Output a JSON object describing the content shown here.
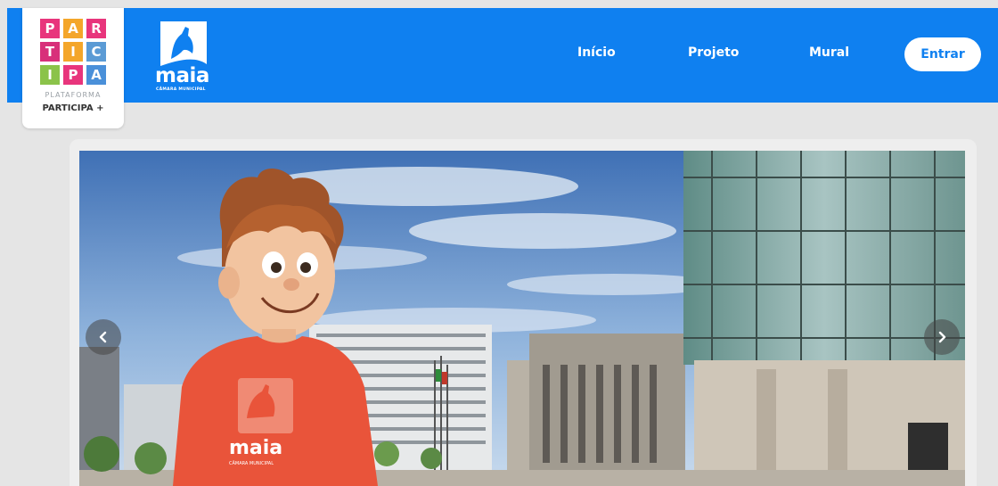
{
  "brand": {
    "logo_letters": [
      "P",
      "A",
      "R",
      "T",
      "I",
      "C",
      "I",
      "P",
      "A"
    ],
    "logo_colors": [
      "#e8357c",
      "#f4a62a",
      "#e8357c",
      "#d8307a",
      "#f4a62a",
      "#5b9bd5",
      "#8bc34a",
      "#e8357c",
      "#4a90d9"
    ],
    "platform_label": "PLATAFORMA",
    "platform_name": "PARTICIPA +"
  },
  "municipality": {
    "name": "maia",
    "subtitle": "CÂMARA MUNICIPAL"
  },
  "nav": {
    "items": [
      {
        "label": "Início"
      },
      {
        "label": "Projeto"
      },
      {
        "label": "Mural"
      }
    ],
    "login_label": "Entrar"
  },
  "carousel": {
    "prev_icon": "chevron-left-icon",
    "next_icon": "chevron-right-icon",
    "shirt_logo": "maia",
    "shirt_logo_sub": "CÂMARA MUNICIPAL"
  },
  "colors": {
    "header": "#0f80f0",
    "background": "#e5e5e5",
    "shirt": "#e9543a"
  }
}
